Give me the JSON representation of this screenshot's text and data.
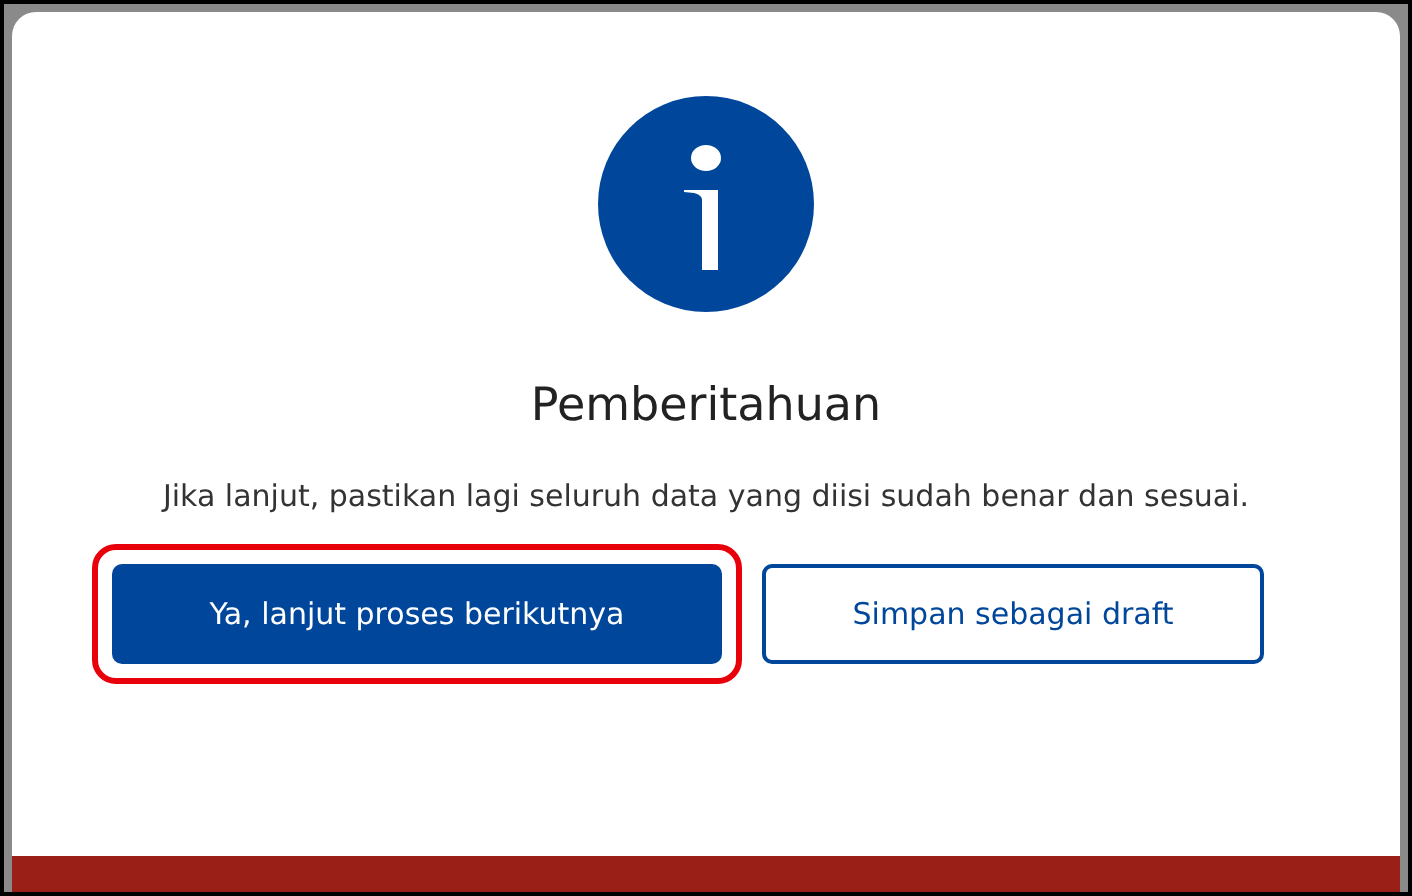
{
  "dialog": {
    "title": "Pemberitahuan",
    "message": "Jika lanjut, pastikan lagi seluruh data yang diisi sudah benar dan sesuai.",
    "buttons": [
      {
        "label": "Ya, lanjut proses berikutnya",
        "kind": "primary",
        "highlighted": true
      },
      {
        "label": "Simpan sebagai draft",
        "kind": "secondary",
        "highlighted": false
      }
    ]
  }
}
